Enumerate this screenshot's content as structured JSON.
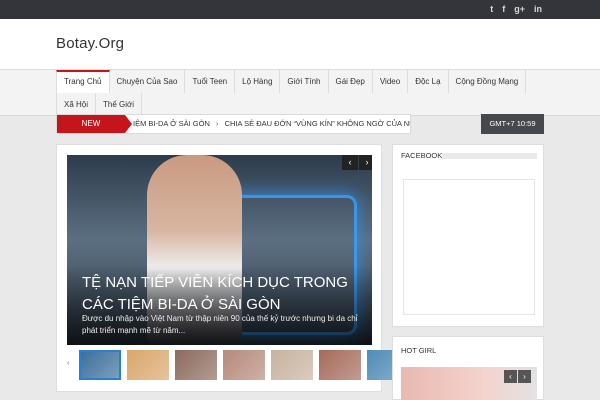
{
  "social": [
    "twitter-icon",
    "facebook-icon",
    "google-plus-icon",
    "linkedin-icon"
  ],
  "social_glyphs": [
    "t",
    "f",
    "g+",
    "in"
  ],
  "site": {
    "title": "Botay.Org"
  },
  "nav": {
    "row1": [
      "Trang Chủ",
      "Chuyện Của Sao",
      "Tuổi Teen",
      "Lộ Hàng",
      "Giới Tính",
      "Gái Đẹp",
      "Video",
      "Độc Lạ",
      "Cộng Đồng Mạng"
    ],
    "row2": [
      "Xã Hội",
      "Thế Giới"
    ]
  },
  "ticker": {
    "badge": "NEW",
    "items": [
      "IỆM BI-DA Ở SÀI GÒN",
      "CHIA SẺ ĐAU ĐỚN “VÙNG KÍN” KHÔNG NGỜ CỦA NỮ DIỄN VI"
    ],
    "separator": "›"
  },
  "clock": "GMT+7 10:59",
  "slider": {
    "title": "TỆ NẠN TIẾP VIÊN KÍCH DỤC TRONG CÁC TIỆM BI-DA Ở SÀI GÒN",
    "description": "Được du nhập vào Việt Nam từ thập niên 90 của thế kỷ trước nhưng bi da chỉ phát triển mạnh mẽ từ năm...",
    "prev": "‹",
    "next": "›",
    "thumb_colors": [
      "#3b6f9c",
      "#d9a66b",
      "#8c6a5d",
      "#b58a7a",
      "#c7b29f",
      "#a56a5a",
      "#4f8bb6"
    ]
  },
  "sidebar": {
    "facebook": {
      "heading": "FACEBOOK"
    },
    "hotgirl": {
      "heading": "HOT GIRL",
      "prev": "‹",
      "next": "›"
    }
  },
  "colors": {
    "accent": "#c4151c",
    "topbar": "#33353a",
    "active_thumb": "#2a7fcf"
  }
}
